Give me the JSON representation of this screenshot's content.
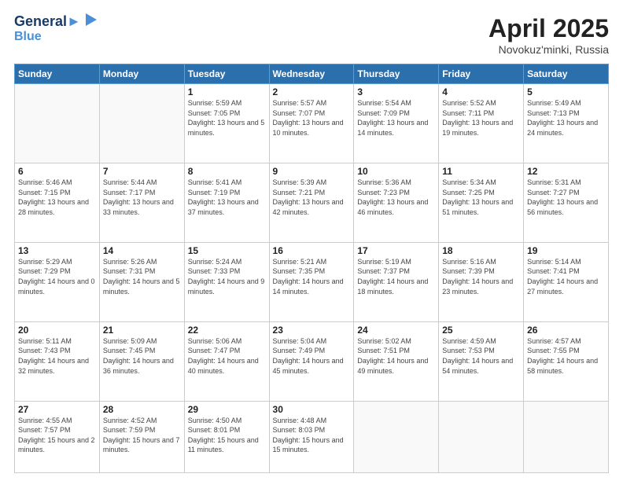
{
  "header": {
    "logo_line1": "General",
    "logo_line2": "Blue",
    "month_title": "April 2025",
    "subtitle": "Novokuz'minki, Russia"
  },
  "days_of_week": [
    "Sunday",
    "Monday",
    "Tuesday",
    "Wednesday",
    "Thursday",
    "Friday",
    "Saturday"
  ],
  "weeks": [
    [
      {
        "num": "",
        "info": ""
      },
      {
        "num": "",
        "info": ""
      },
      {
        "num": "1",
        "info": "Sunrise: 5:59 AM\nSunset: 7:05 PM\nDaylight: 13 hours and 5 minutes."
      },
      {
        "num": "2",
        "info": "Sunrise: 5:57 AM\nSunset: 7:07 PM\nDaylight: 13 hours and 10 minutes."
      },
      {
        "num": "3",
        "info": "Sunrise: 5:54 AM\nSunset: 7:09 PM\nDaylight: 13 hours and 14 minutes."
      },
      {
        "num": "4",
        "info": "Sunrise: 5:52 AM\nSunset: 7:11 PM\nDaylight: 13 hours and 19 minutes."
      },
      {
        "num": "5",
        "info": "Sunrise: 5:49 AM\nSunset: 7:13 PM\nDaylight: 13 hours and 24 minutes."
      }
    ],
    [
      {
        "num": "6",
        "info": "Sunrise: 5:46 AM\nSunset: 7:15 PM\nDaylight: 13 hours and 28 minutes."
      },
      {
        "num": "7",
        "info": "Sunrise: 5:44 AM\nSunset: 7:17 PM\nDaylight: 13 hours and 33 minutes."
      },
      {
        "num": "8",
        "info": "Sunrise: 5:41 AM\nSunset: 7:19 PM\nDaylight: 13 hours and 37 minutes."
      },
      {
        "num": "9",
        "info": "Sunrise: 5:39 AM\nSunset: 7:21 PM\nDaylight: 13 hours and 42 minutes."
      },
      {
        "num": "10",
        "info": "Sunrise: 5:36 AM\nSunset: 7:23 PM\nDaylight: 13 hours and 46 minutes."
      },
      {
        "num": "11",
        "info": "Sunrise: 5:34 AM\nSunset: 7:25 PM\nDaylight: 13 hours and 51 minutes."
      },
      {
        "num": "12",
        "info": "Sunrise: 5:31 AM\nSunset: 7:27 PM\nDaylight: 13 hours and 56 minutes."
      }
    ],
    [
      {
        "num": "13",
        "info": "Sunrise: 5:29 AM\nSunset: 7:29 PM\nDaylight: 14 hours and 0 minutes."
      },
      {
        "num": "14",
        "info": "Sunrise: 5:26 AM\nSunset: 7:31 PM\nDaylight: 14 hours and 5 minutes."
      },
      {
        "num": "15",
        "info": "Sunrise: 5:24 AM\nSunset: 7:33 PM\nDaylight: 14 hours and 9 minutes."
      },
      {
        "num": "16",
        "info": "Sunrise: 5:21 AM\nSunset: 7:35 PM\nDaylight: 14 hours and 14 minutes."
      },
      {
        "num": "17",
        "info": "Sunrise: 5:19 AM\nSunset: 7:37 PM\nDaylight: 14 hours and 18 minutes."
      },
      {
        "num": "18",
        "info": "Sunrise: 5:16 AM\nSunset: 7:39 PM\nDaylight: 14 hours and 23 minutes."
      },
      {
        "num": "19",
        "info": "Sunrise: 5:14 AM\nSunset: 7:41 PM\nDaylight: 14 hours and 27 minutes."
      }
    ],
    [
      {
        "num": "20",
        "info": "Sunrise: 5:11 AM\nSunset: 7:43 PM\nDaylight: 14 hours and 32 minutes."
      },
      {
        "num": "21",
        "info": "Sunrise: 5:09 AM\nSunset: 7:45 PM\nDaylight: 14 hours and 36 minutes."
      },
      {
        "num": "22",
        "info": "Sunrise: 5:06 AM\nSunset: 7:47 PM\nDaylight: 14 hours and 40 minutes."
      },
      {
        "num": "23",
        "info": "Sunrise: 5:04 AM\nSunset: 7:49 PM\nDaylight: 14 hours and 45 minutes."
      },
      {
        "num": "24",
        "info": "Sunrise: 5:02 AM\nSunset: 7:51 PM\nDaylight: 14 hours and 49 minutes."
      },
      {
        "num": "25",
        "info": "Sunrise: 4:59 AM\nSunset: 7:53 PM\nDaylight: 14 hours and 54 minutes."
      },
      {
        "num": "26",
        "info": "Sunrise: 4:57 AM\nSunset: 7:55 PM\nDaylight: 14 hours and 58 minutes."
      }
    ],
    [
      {
        "num": "27",
        "info": "Sunrise: 4:55 AM\nSunset: 7:57 PM\nDaylight: 15 hours and 2 minutes."
      },
      {
        "num": "28",
        "info": "Sunrise: 4:52 AM\nSunset: 7:59 PM\nDaylight: 15 hours and 7 minutes."
      },
      {
        "num": "29",
        "info": "Sunrise: 4:50 AM\nSunset: 8:01 PM\nDaylight: 15 hours and 11 minutes."
      },
      {
        "num": "30",
        "info": "Sunrise: 4:48 AM\nSunset: 8:03 PM\nDaylight: 15 hours and 15 minutes."
      },
      {
        "num": "",
        "info": ""
      },
      {
        "num": "",
        "info": ""
      },
      {
        "num": "",
        "info": ""
      }
    ]
  ]
}
